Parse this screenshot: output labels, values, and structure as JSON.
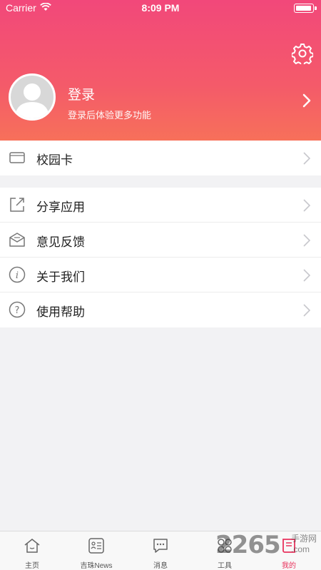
{
  "status_bar": {
    "carrier": "Carrier",
    "time": "8:09 PM"
  },
  "header": {
    "login_title": "登录",
    "login_subtitle": "登录后体验更多功能",
    "settings_icon": "gear-icon",
    "avatar_icon": "user-silhouette-icon"
  },
  "menu_primary": [
    {
      "label": "校园卡",
      "icon": "card-icon"
    }
  ],
  "menu_secondary": [
    {
      "label": "分享应用",
      "icon": "share-icon"
    },
    {
      "label": "意见反馈",
      "icon": "feedback-mail-icon"
    },
    {
      "label": "关于我们",
      "icon": "info-icon"
    },
    {
      "label": "使用帮助",
      "icon": "help-icon"
    }
  ],
  "tabbar": {
    "tabs": [
      {
        "label": "主页",
        "icon": "home-icon",
        "active": false
      },
      {
        "label": "吉珠News",
        "icon": "news-icon",
        "active": false
      },
      {
        "label": "消息",
        "icon": "message-icon",
        "active": false
      },
      {
        "label": "工具",
        "icon": "tools-icon",
        "active": false
      },
      {
        "label": "我的",
        "icon": "profile-book-icon",
        "active": true
      }
    ]
  },
  "watermark": {
    "number": "2265",
    "site": "手游网",
    "domain": ".com"
  },
  "colors": {
    "accent": "#e8325c",
    "header_top": "#f2487a",
    "header_bottom": "#f7705a"
  }
}
